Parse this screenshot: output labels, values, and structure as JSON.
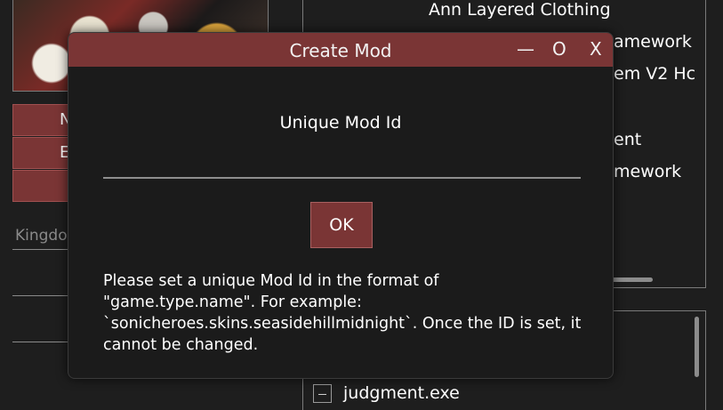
{
  "background": {
    "side_buttons": [
      "N",
      "E",
      ""
    ],
    "search_placeholder": "Kingdo",
    "mod_list": [
      "Ann Layered Clothing",
      "amework",
      "em V2 Hc",
      "ent",
      "mework"
    ],
    "apps": [
      {
        "label": "judgment.exe"
      }
    ]
  },
  "dialog": {
    "title": "Create Mod",
    "minimize": "—",
    "maximize": "O",
    "close": "X",
    "field_label": "Unique Mod Id",
    "input_value": "",
    "ok_label": "OK",
    "help_text": "Please set a unique Mod Id in the format of \"game.type.name\". For example: `sonicheroes.skins.seasidehillmidnight`. Once the ID is set, it cannot be changed."
  },
  "colors": {
    "accent": "#7a3535",
    "background": "#1e1e1e",
    "dialog_bg": "#1b1b1b"
  }
}
